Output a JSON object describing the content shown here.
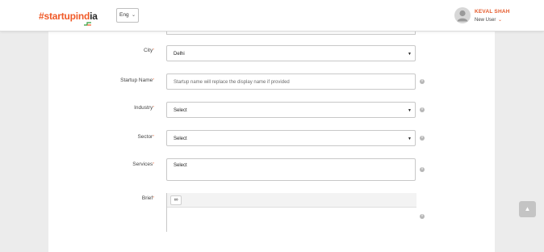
{
  "header": {
    "logo": {
      "hash": "#",
      "startup": "startup",
      "ind": "ind",
      "ia": "ia"
    },
    "language": "Eng",
    "user": {
      "name": "KEVAL SHAH",
      "role": "New User"
    }
  },
  "form": {
    "city": {
      "label": "City",
      "required": "*",
      "value": "Delhi"
    },
    "startup_name": {
      "label": "Startup Name",
      "required": "*",
      "placeholder": "Startup name will replace the display name if provided"
    },
    "industry": {
      "label": "Industry",
      "required": "*",
      "value": "Select"
    },
    "sector": {
      "label": "Sector",
      "required": "*",
      "value": "Select"
    },
    "services": {
      "label": "Services",
      "required": "*",
      "value": "Select"
    },
    "brief": {
      "label": "Brief",
      "required": "*"
    }
  },
  "icons": {
    "info": "info-icon",
    "dropdown": "caret-down-icon",
    "link": "link-icon",
    "scroll_top": "caret-up-icon"
  },
  "colors": {
    "brand": "#f05a28",
    "background": "#ececec",
    "panel": "#ffffff"
  }
}
